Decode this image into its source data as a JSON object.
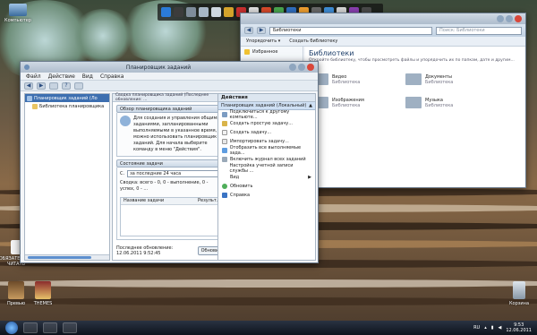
{
  "desktop": {
    "icons": [
      {
        "label": "Компьютер",
        "name": "desktop-icon-computer"
      },
      {
        "label": "ОБЯЗАТЕЛЬНО ЧИТАТЬ",
        "name": "desktop-icon-readme"
      },
      {
        "label": "Превью",
        "name": "desktop-icon-preview"
      },
      {
        "label": "THEMES",
        "name": "desktop-icon-themes"
      },
      {
        "label": "Корзина",
        "name": "desktop-icon-recycle"
      }
    ]
  },
  "scheduler": {
    "title": "Планировщик заданий",
    "menu": [
      "Файл",
      "Действие",
      "Вид",
      "Справка"
    ],
    "tree": [
      {
        "label": "Планировщик заданий (Ло",
        "selected": true
      },
      {
        "label": "Библиотека планировщика",
        "selected": false
      }
    ],
    "mid_header": "Сводка планировщика заданий (Последнее обновление: ...",
    "overview": {
      "head": "Обзор планировщика заданий",
      "text": "Для создания и управления общими заданиями, запланированными выполняемыми в указанное время, можно использовать планировщик заданий. Для начала выберите команду в меню \"Действия\"."
    },
    "status": {
      "head": "Состояние задачи",
      "select": "за последние 24 часа",
      "summary": "Сводка: всего - 0, 0 - выполнение, 0 - успех, 0 - ...",
      "col_name": "Название задачи",
      "col_result": "Результ..."
    },
    "footer": {
      "updated": "Последнее обновление: 12.06.2011 9:52:45",
      "refresh": "Обновить"
    },
    "actions": {
      "head": "Действия",
      "section": "Планировщик заданий (Локальный)",
      "items": [
        "Подключиться к другому компьюте...",
        "Создать простую задачу...",
        "Создать задачу...",
        "Импортировать задачу...",
        "Отобразить все выполняемые зада...",
        "Включить журнал всех заданий",
        "Настройка учетной записи службы ...",
        "Вид",
        "Обновить",
        "Справка"
      ]
    }
  },
  "explorer": {
    "address": "Библиотеки",
    "search_placeholder": "Поиск: Библиотеки",
    "commands": [
      "Упорядочить ▾",
      "Создать библиотеку"
    ],
    "nav_items": [
      "Избранное"
    ],
    "heading": "Библиотеки",
    "subheading": "Откройте библиотеку, чтобы просмотреть файлы и упорядочить их по папкам, дате и другим...",
    "libraries": [
      {
        "name": "Видео",
        "sub": "Библиотека"
      },
      {
        "name": "Документы",
        "sub": "Библиотека"
      },
      {
        "name": "Изображения",
        "sub": "Библиотека"
      },
      {
        "name": "Музыка",
        "sub": "Библиотека"
      }
    ]
  },
  "taskbar": {
    "lang": "RU",
    "time": "9:53",
    "date": "12.06.2011"
  }
}
